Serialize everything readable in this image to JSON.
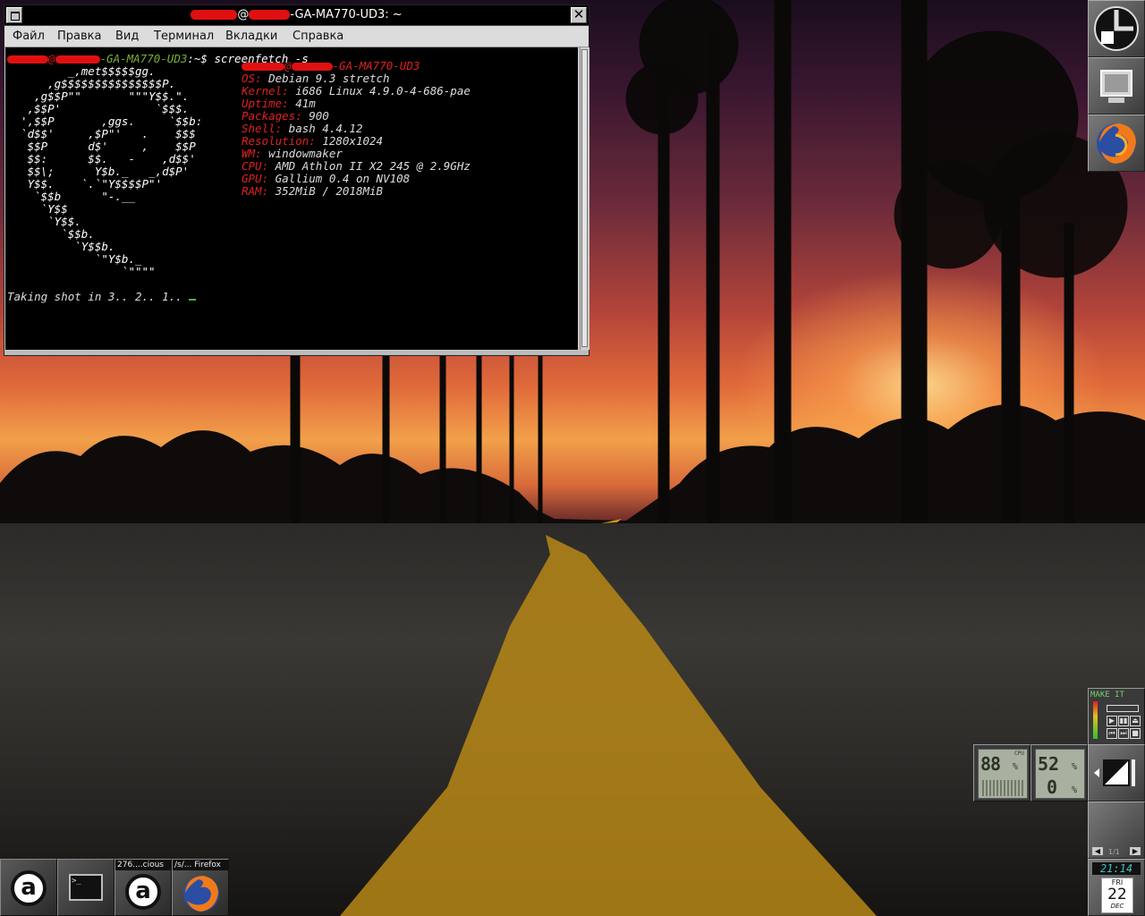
{
  "window": {
    "title_suffix": "-GA-MA770-UD3: ~",
    "title_at": "@"
  },
  "menu": [
    "Файл",
    "Правка",
    "Вид",
    "Терминал",
    "Вкладки",
    "Справка"
  ],
  "terminal": {
    "prompt_at": "@",
    "prompt_host": "-GA-MA770-UD3",
    "prompt_path": ":~$",
    "command": " screenfetch -s",
    "logo_lines": [
      "         _,met$$$$$gg.",
      "      ,g$$$$$$$$$$$$$$$P.",
      "    ,g$$P\"\"       \"\"\"Y$$.\".",
      "   ,$$P'              `$$$.",
      "  ',$$P       ,ggs.     `$$b:",
      "  `d$$'     ,$P\"'   .    $$$",
      "   $$P      d$'     ,    $$P",
      "   $$:      $$.   -    ,d$$'",
      "   $$\\;      Y$b._   _,d$P'",
      "   Y$$.    `.`\"Y$$$$P\"'",
      "    `$$b      \"-.__",
      "     `Y$$",
      "      `Y$$.",
      "        `$$b.",
      "          `Y$$b.",
      "             `\"Y$b._",
      "                 `\"\"\"\""
    ],
    "info_header_at": "@",
    "info_header_host": "-GA-MA770-UD3",
    "info": [
      {
        "k": "OS:",
        "v": " Debian 9.3 stretch"
      },
      {
        "k": "Kernel:",
        "v": " i686 Linux 4.9.0-4-686-pae"
      },
      {
        "k": "Uptime:",
        "v": " 41m"
      },
      {
        "k": "Packages:",
        "v": " 900"
      },
      {
        "k": "Shell:",
        "v": " bash 4.4.12"
      },
      {
        "k": "Resolution:",
        "v": " 1280x1024"
      },
      {
        "k": "WM:",
        "v": " windowmaker"
      },
      {
        "k": "CPU:",
        "v": " AMD Athlon II X2 245 @ 2.9GHz"
      },
      {
        "k": "GPU:",
        "v": " Gallium 0.4 on NV108"
      },
      {
        "k": "RAM:",
        "v": " 352MiB / 2018MiB"
      }
    ],
    "shot_text": "Taking shot in 3.. 2.. 1.. "
  },
  "taskbar": {
    "mini3_label": "276....cious",
    "mini4_label": "/s/... Firefox",
    "a_glyph": "a",
    "term_glyph": ">_"
  },
  "dockapps": {
    "make_it_label": "MAKE IT",
    "cpu_left_value": "88",
    "cpu_left_unit": "%",
    "cpu_label": "CPU",
    "mem_top_value": "52",
    "mem_bottom_value": "0",
    "pct": "%",
    "ws_label": "1/1",
    "clock_time": "21:14",
    "cal_day": "FRI",
    "cal_date": "22",
    "cal_month": "DEC"
  },
  "colors": {
    "prompt_user": "#e01010",
    "prompt_host": "#7ab030",
    "info_key": "#e02020"
  }
}
